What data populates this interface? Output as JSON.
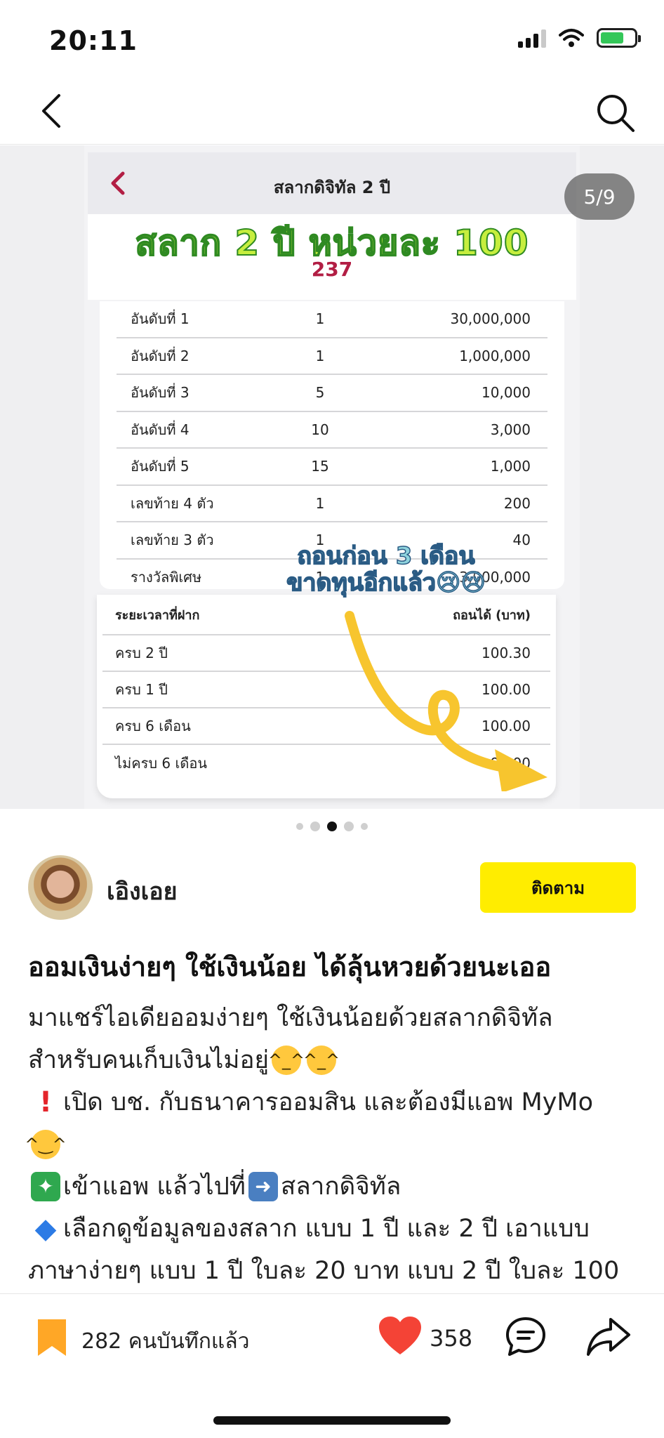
{
  "status_bar": {
    "time": "20:11"
  },
  "carousel": {
    "page_indicator": "5/9",
    "slide": {
      "header_title": "สลากดิจิทัล 2 ปี",
      "overlay_title": "สลาก 2 ปี หน่วยละ 100",
      "number": "237",
      "prize_rows": [
        {
          "name": "อันดับที่ 1",
          "count": "1",
          "amount": "30,000,000"
        },
        {
          "name": "อันดับที่ 2",
          "count": "1",
          "amount": "1,000,000"
        },
        {
          "name": "อันดับที่ 3",
          "count": "5",
          "amount": "10,000"
        },
        {
          "name": "อันดับที่ 4",
          "count": "10",
          "amount": "3,000"
        },
        {
          "name": "อันดับที่ 5",
          "count": "15",
          "amount": "1,000"
        },
        {
          "name": "เลขท้าย 4 ตัว",
          "count": "1",
          "amount": "200"
        },
        {
          "name": "เลขท้าย 3 ตัว",
          "count": "1",
          "amount": "40"
        },
        {
          "name": "รางวัลพิเศษ",
          "count": "1",
          "amount": "3,000,000"
        }
      ],
      "withdraw_header": {
        "period": "ระยะเวลาที่ฝาก",
        "amount": "ถอนได้ (บาท)"
      },
      "withdraw_rows": [
        {
          "period": "ครบ 2 ปี",
          "amount": "100.30"
        },
        {
          "period": "ครบ 1 ปี",
          "amount": "100.00"
        },
        {
          "period": "ครบ 6 เดือน",
          "amount": "100.00"
        },
        {
          "period": "ไม่ครบ 6 เดือน",
          "amount": "98.00"
        }
      ],
      "overlay_note_line1": "ถอนก่อน 3 เดือน",
      "overlay_note_line2": "ขาดทุนอีกแล้ว😢😢"
    },
    "dots_total": 5,
    "dots_active_index": 2
  },
  "author": {
    "name": "เอิงเอย",
    "follow_label": "ติดตาม"
  },
  "post": {
    "title": "ออมเงินง่ายๆ ใช้เงินน้อย ได้ลุ้นหวยด้วยนะเออ",
    "line1": "มาแชร์ไอเดียออมง่ายๆ ใช้เงินน้อยด้วยสลากดิจิทัล",
    "line2": "สำหรับคนเก็บเงินไม่อยู่",
    "line3": "เปิด บช. กับธนาคารออมสิน และต้องมีแอพ MyMo",
    "line5a": "เข้าแอพ แล้วไปที่",
    "line5b": "สลากดิจิทัล",
    "line6": "เลือกดูข้อมูลของสลาก แบบ 1 ปี และ 2 ปี เอาแบบ",
    "line7": "ภาษาง่ายๆ แบบ 1 ปี ใบละ 20 บาท แบบ 2 ปี ใบละ 100"
  },
  "bottom_bar": {
    "save_count_text": "282 คนบันทึกแล้ว",
    "like_count": "358"
  },
  "colors": {
    "follow_yellow": "#ffed00",
    "heart_red": "#f44336",
    "bookmark_orange": "#ffa726",
    "battery_green": "#34c759"
  }
}
